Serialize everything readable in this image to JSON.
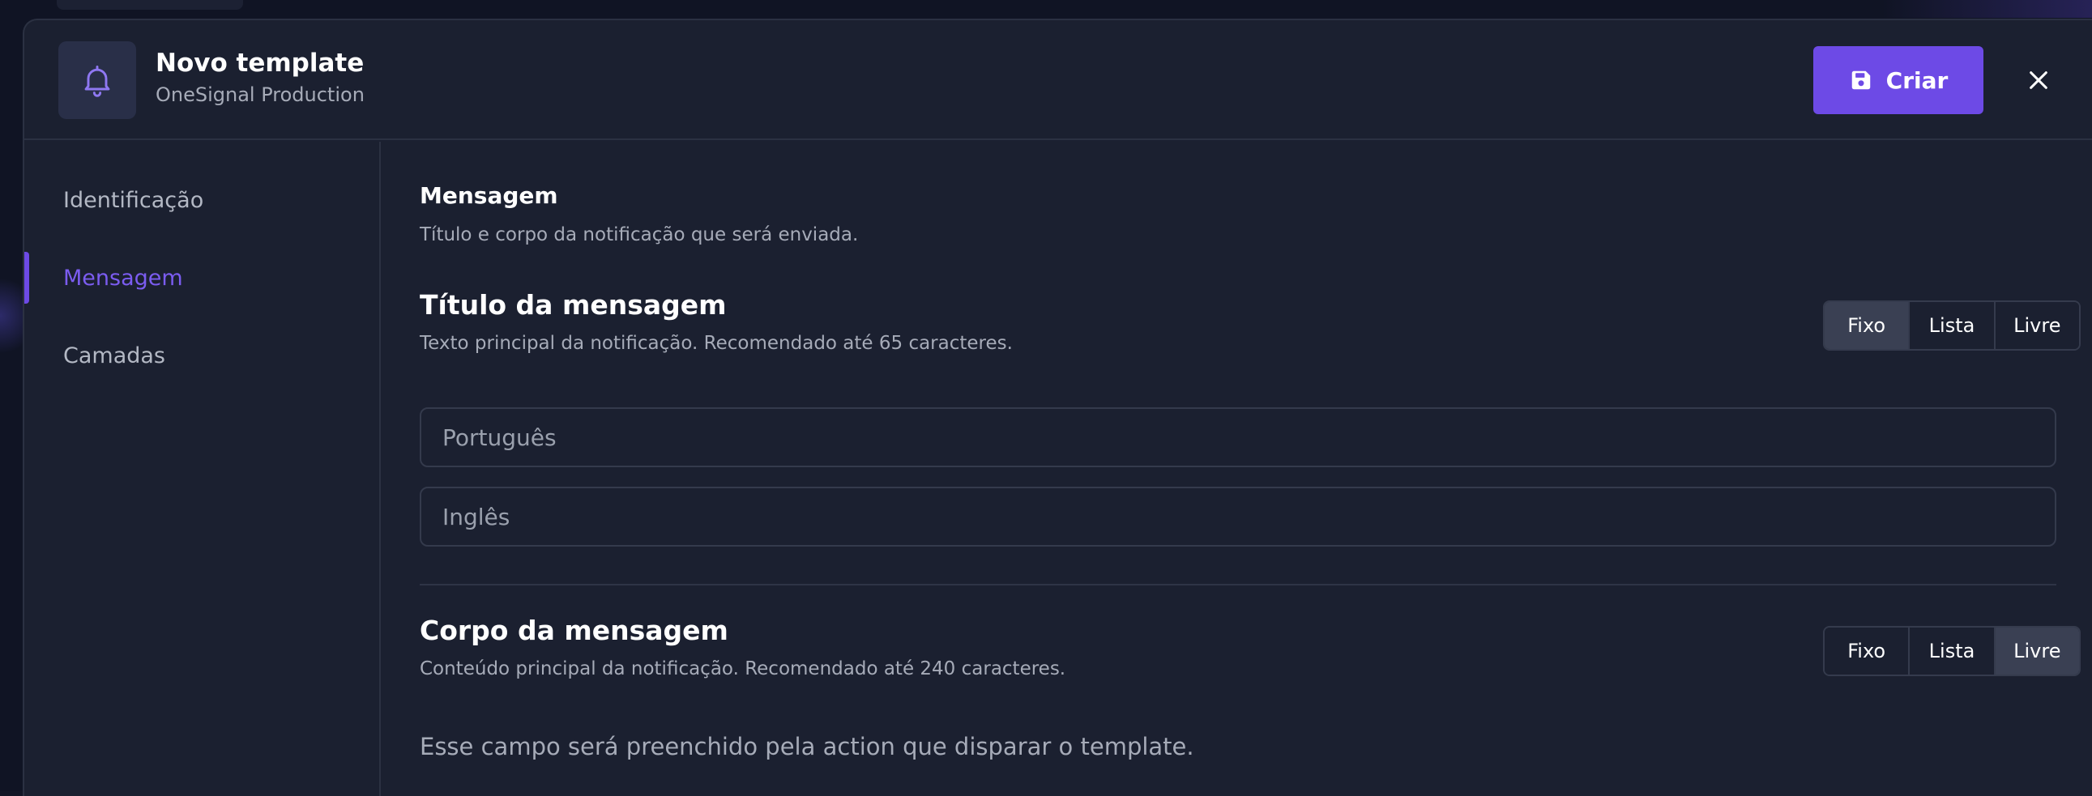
{
  "header": {
    "title": "Novo template",
    "subtitle": "OneSignal Production",
    "icon": "bell-icon",
    "create_label": "Criar",
    "create_icon": "floppy-disk-icon",
    "close_icon": "close-icon",
    "accent_color": "#6d4ae6"
  },
  "sidebar": {
    "items": [
      {
        "label": "Identificação",
        "active": false
      },
      {
        "label": "Mensagem",
        "active": true
      },
      {
        "label": "Camadas",
        "active": false
      }
    ]
  },
  "content": {
    "section_title": "Mensagem",
    "section_desc": "Título e corpo da notificação que será enviada.",
    "title_field": {
      "label": "Título da mensagem",
      "desc": "Texto principal da notificação. Recomendado até 65 caracteres.",
      "modes": [
        "Fixo",
        "Lista",
        "Livre"
      ],
      "selected_mode": "Fixo",
      "inputs": [
        {
          "placeholder": "Português",
          "value": ""
        },
        {
          "placeholder": "Inglês",
          "value": ""
        }
      ]
    },
    "body_field": {
      "label": "Corpo da mensagem",
      "desc": "Conteúdo principal da notificação. Recomendado até 240 caracteres.",
      "modes": [
        "Fixo",
        "Lista",
        "Livre"
      ],
      "selected_mode": "Livre",
      "info": "Esse campo será preenchido pela action que disparar o template."
    }
  }
}
